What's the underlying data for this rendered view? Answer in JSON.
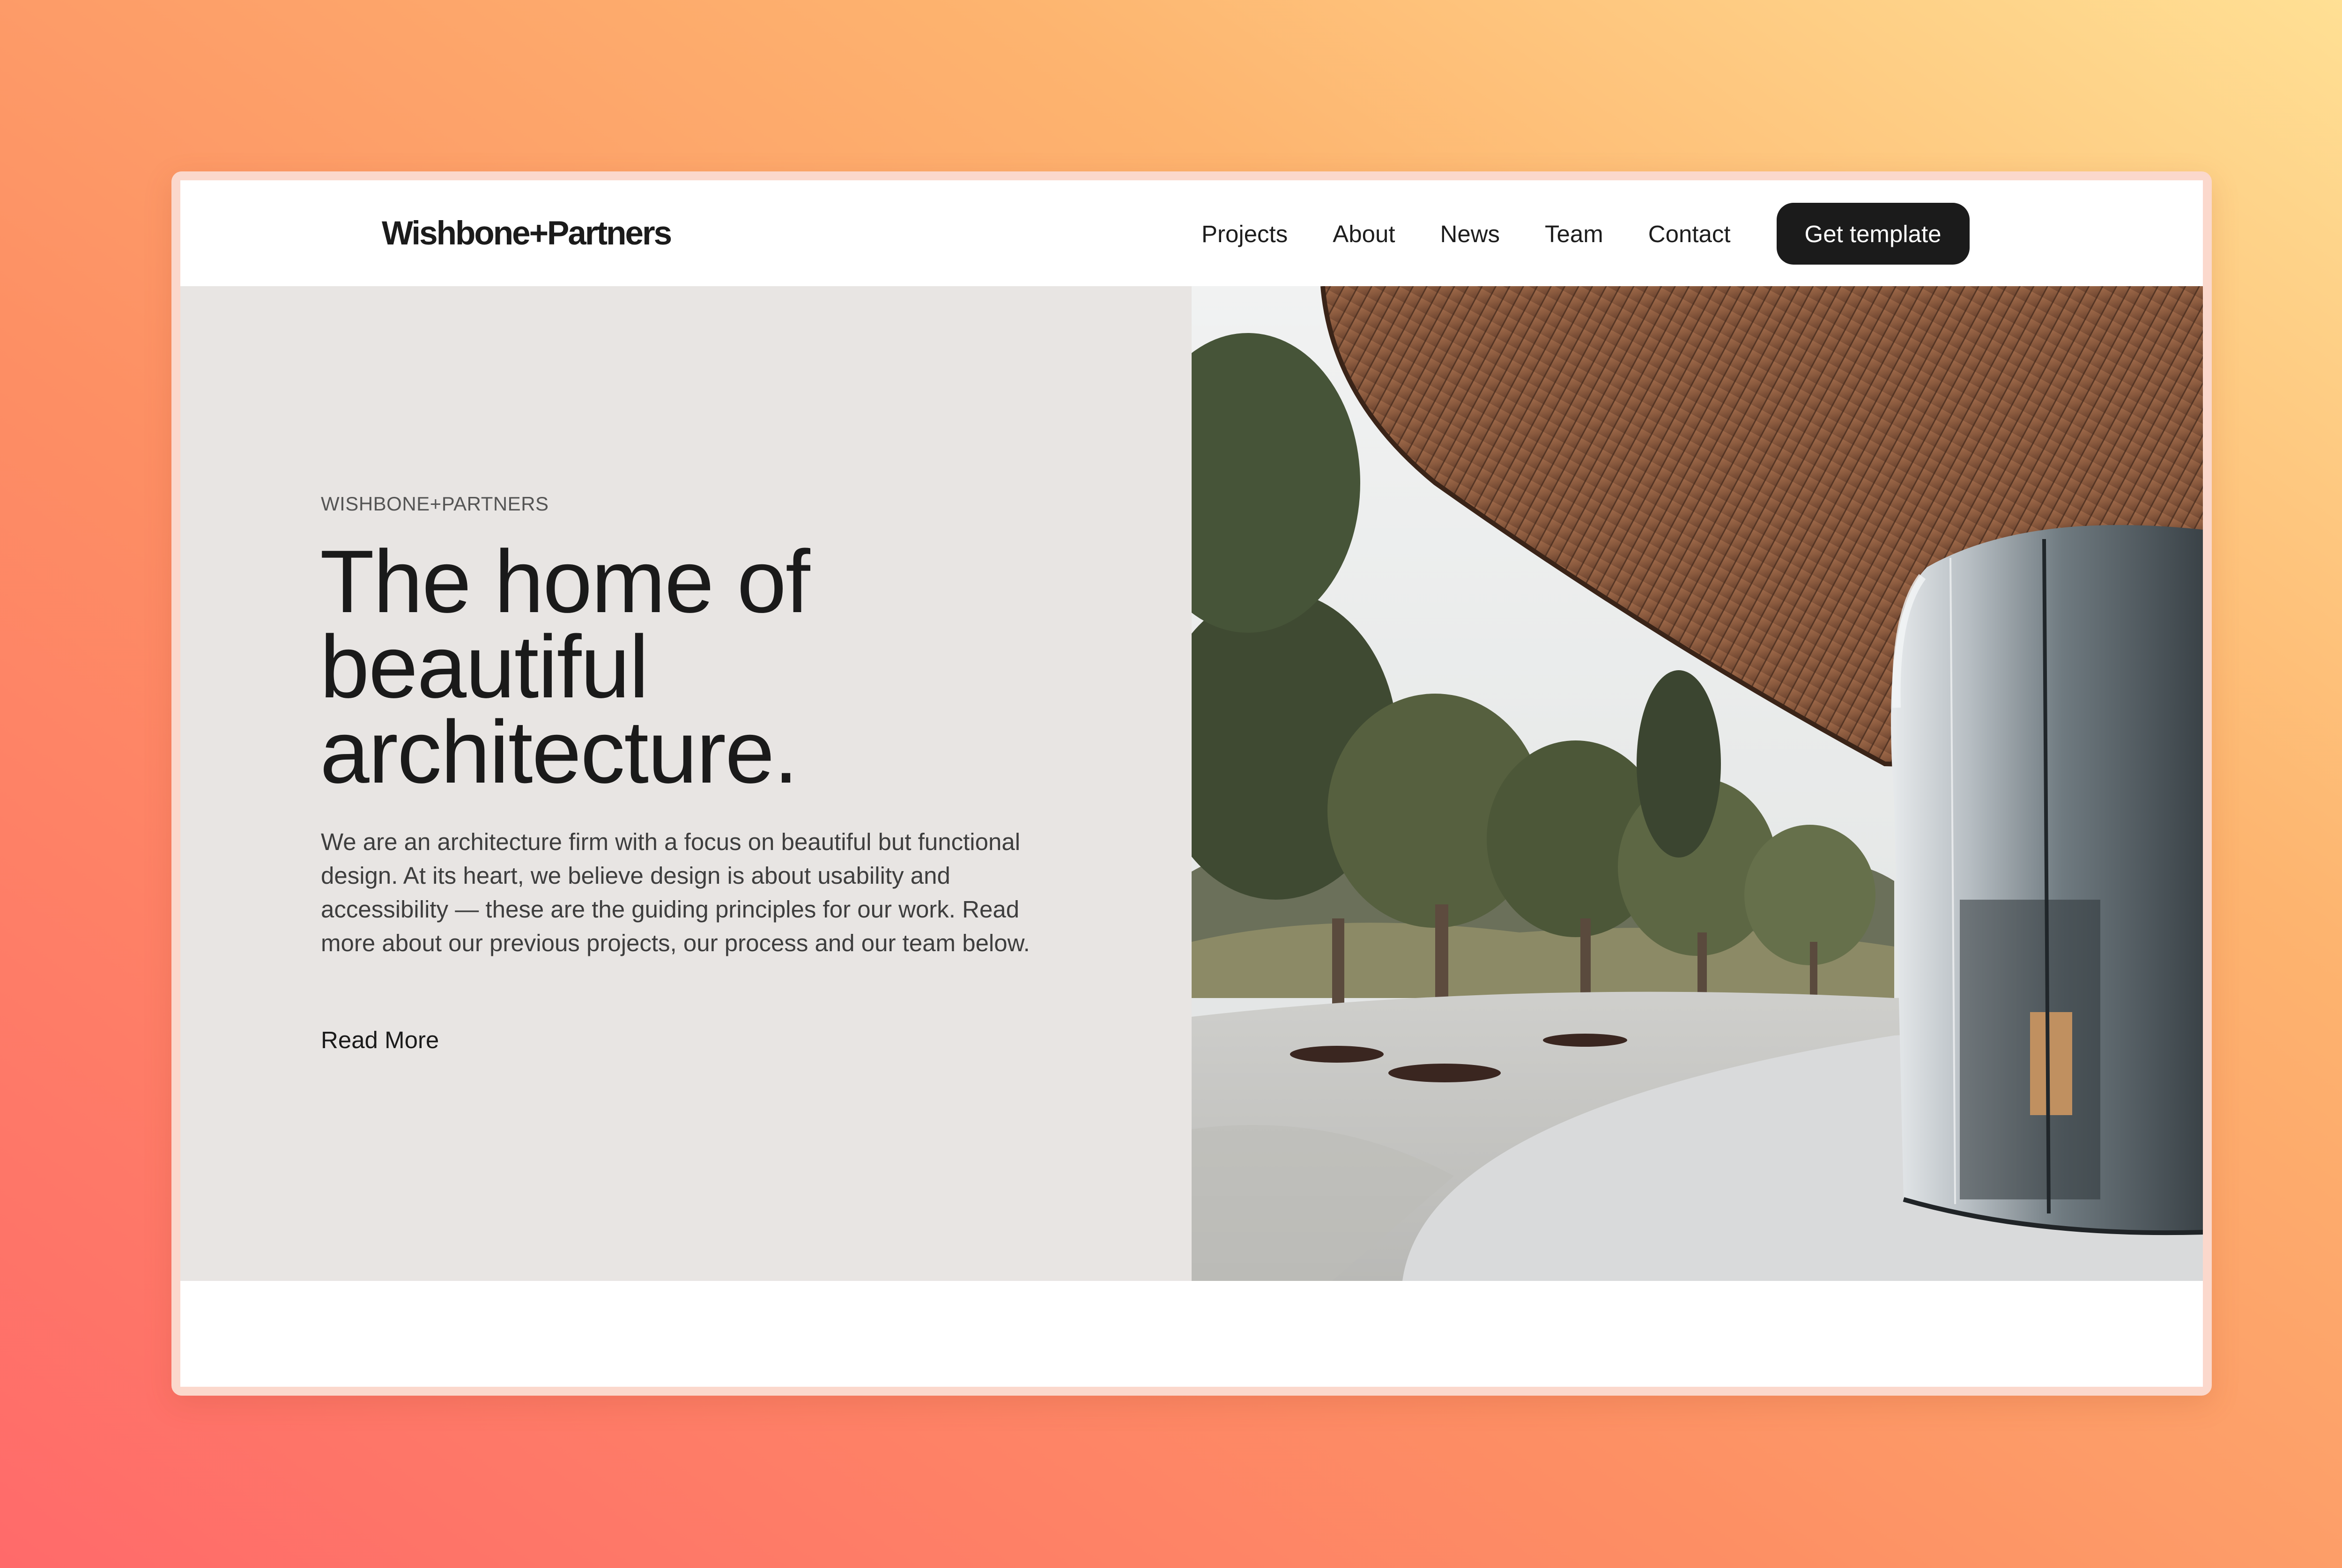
{
  "brand": {
    "logo": "Wishbone+Partners"
  },
  "nav": {
    "items": [
      {
        "label": "Projects"
      },
      {
        "label": "About"
      },
      {
        "label": "News"
      },
      {
        "label": "Team"
      },
      {
        "label": "Contact"
      }
    ],
    "cta_label": "Get template"
  },
  "hero": {
    "eyebrow": "WISHBONE+PARTNERS",
    "headline_lines": [
      "The home of",
      "beautiful",
      "architecture."
    ],
    "body": "We are an architecture firm with a focus on beautiful but functional design. At its heart, we believe design is about usability and accessibility — these are the guiding principles for our work. Read more about our previous projects, our process and our team below.",
    "read_more_label": "Read More",
    "image_subject": "architecture-photo"
  },
  "colors": {
    "accent_dark": "#1b1b1b",
    "hero_panel": "#e8e5e3",
    "background_gradient_start": "#ff6a6a",
    "background_gradient_end": "#ffe195"
  }
}
